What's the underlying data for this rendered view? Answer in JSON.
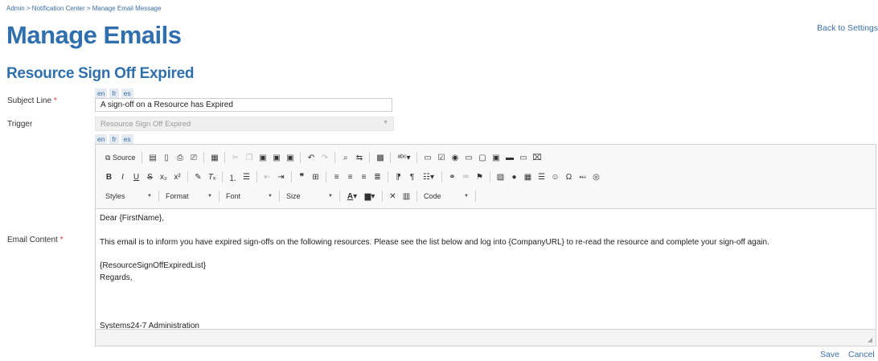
{
  "breadcrumb": "Admin > Notification Center > Manage Email Message",
  "page_title": "Manage Emails",
  "back_link": "Back to Settings",
  "section_title": "Resource Sign Off Expired",
  "languages": [
    "en",
    "fr",
    "es"
  ],
  "subject": {
    "label": "Subject Line",
    "required": "*",
    "value": "A sign-off on a Resource has Expired"
  },
  "trigger": {
    "label": "Trigger",
    "value": "Resource Sign Off Expired"
  },
  "email_content": {
    "label": "Email Content",
    "required": "*"
  },
  "toolbar": {
    "source_label": "Source",
    "styles_label": "Styles",
    "format_label": "Format",
    "font_label": "Font",
    "size_label": "Size",
    "code_label": "Code"
  },
  "body": {
    "greeting": "Dear {FirstName},",
    "paragraph": "This email is to inform you have expired sign-offs on the following resources. Please see the list below and log into {CompanyURL} to re-read the resource and complete your sign-off again.",
    "placeholder_list": "{ResourceSignOffExpiredList}",
    "closing": "Regards,",
    "signature": "Systems24-7 Administration"
  },
  "actions": {
    "save": "Save",
    "cancel": "Cancel"
  }
}
